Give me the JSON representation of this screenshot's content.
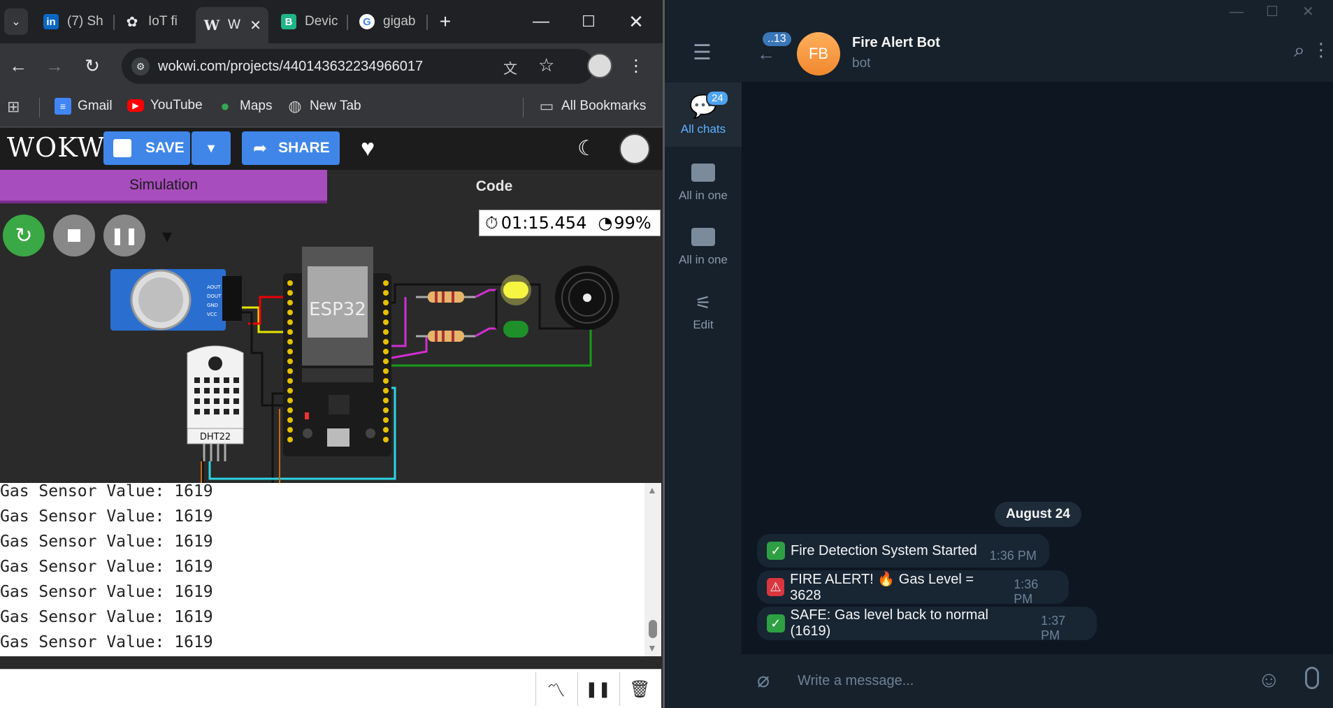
{
  "browser": {
    "tabs": [
      {
        "label": "(7) Sh",
        "favicon": "linkedin-icon",
        "color": "#0a66c2"
      },
      {
        "label": "IoT fi",
        "favicon": "openai-icon",
        "color": "#e8eaed"
      },
      {
        "label": "W",
        "favicon": "wokwi-icon",
        "color": "#e8eaed",
        "active": true
      },
      {
        "label": "Devic",
        "favicon": "b-icon",
        "color": "#20b486"
      },
      {
        "label": "gigab",
        "favicon": "google-icon",
        "color": "#4285f4"
      }
    ],
    "new_tab": "+",
    "url": "wokwi.com/projects/440143632234966017",
    "bookmarks": [
      {
        "label": "Gmail",
        "icon": "docs-icon"
      },
      {
        "label": "YouTube",
        "icon": "youtube-icon"
      },
      {
        "label": "Maps",
        "icon": "maps-icon"
      },
      {
        "label": "New Tab",
        "icon": "globe-icon"
      }
    ],
    "all_bookmarks": "All Bookmarks"
  },
  "wokwi": {
    "logo": "WOKWI",
    "save_label": "SAVE",
    "share_label": "SHARE",
    "tabs": {
      "simulation": "Simulation",
      "code": "Code"
    },
    "timer": "01:15.454",
    "speed": "99%",
    "components": {
      "esp32_label": "ESP32",
      "dht_label": "DHT22",
      "gas_pins": [
        "AOUT",
        "DOUT",
        "GND",
        "VCC"
      ]
    },
    "serial_lines": [
      "Gas Sensor Value: 1619",
      "Gas Sensor Value: 1619",
      "Gas Sensor Value: 1619",
      "Gas Sensor Value: 1619",
      "Gas Sensor Value: 1619",
      "Gas Sensor Value: 1619",
      "Gas Sensor Value: 1619"
    ]
  },
  "telegram": {
    "back_badge": "..13",
    "chat_name": "Fire Alert Bot",
    "chat_status": "bot",
    "avatar_initials": "FB",
    "folders": [
      {
        "label": "All chats",
        "badge": "24",
        "active": true
      },
      {
        "label": "All in one",
        "active": false
      },
      {
        "label": "All in one",
        "active": false
      },
      {
        "label": "Edit",
        "active": false
      }
    ],
    "date_chip": "August 24",
    "messages": [
      {
        "emoji": "✅",
        "text": "Fire Detection System Started",
        "time": "1:36 PM"
      },
      {
        "emoji": "🚨",
        "text": "FIRE ALERT! 🔥 Gas Level = 3628",
        "time": "1:36 PM"
      },
      {
        "emoji": "✅",
        "text": "SAFE: Gas level back to normal (1619)",
        "time": "1:37 PM"
      }
    ],
    "input_placeholder": "Write a message..."
  }
}
